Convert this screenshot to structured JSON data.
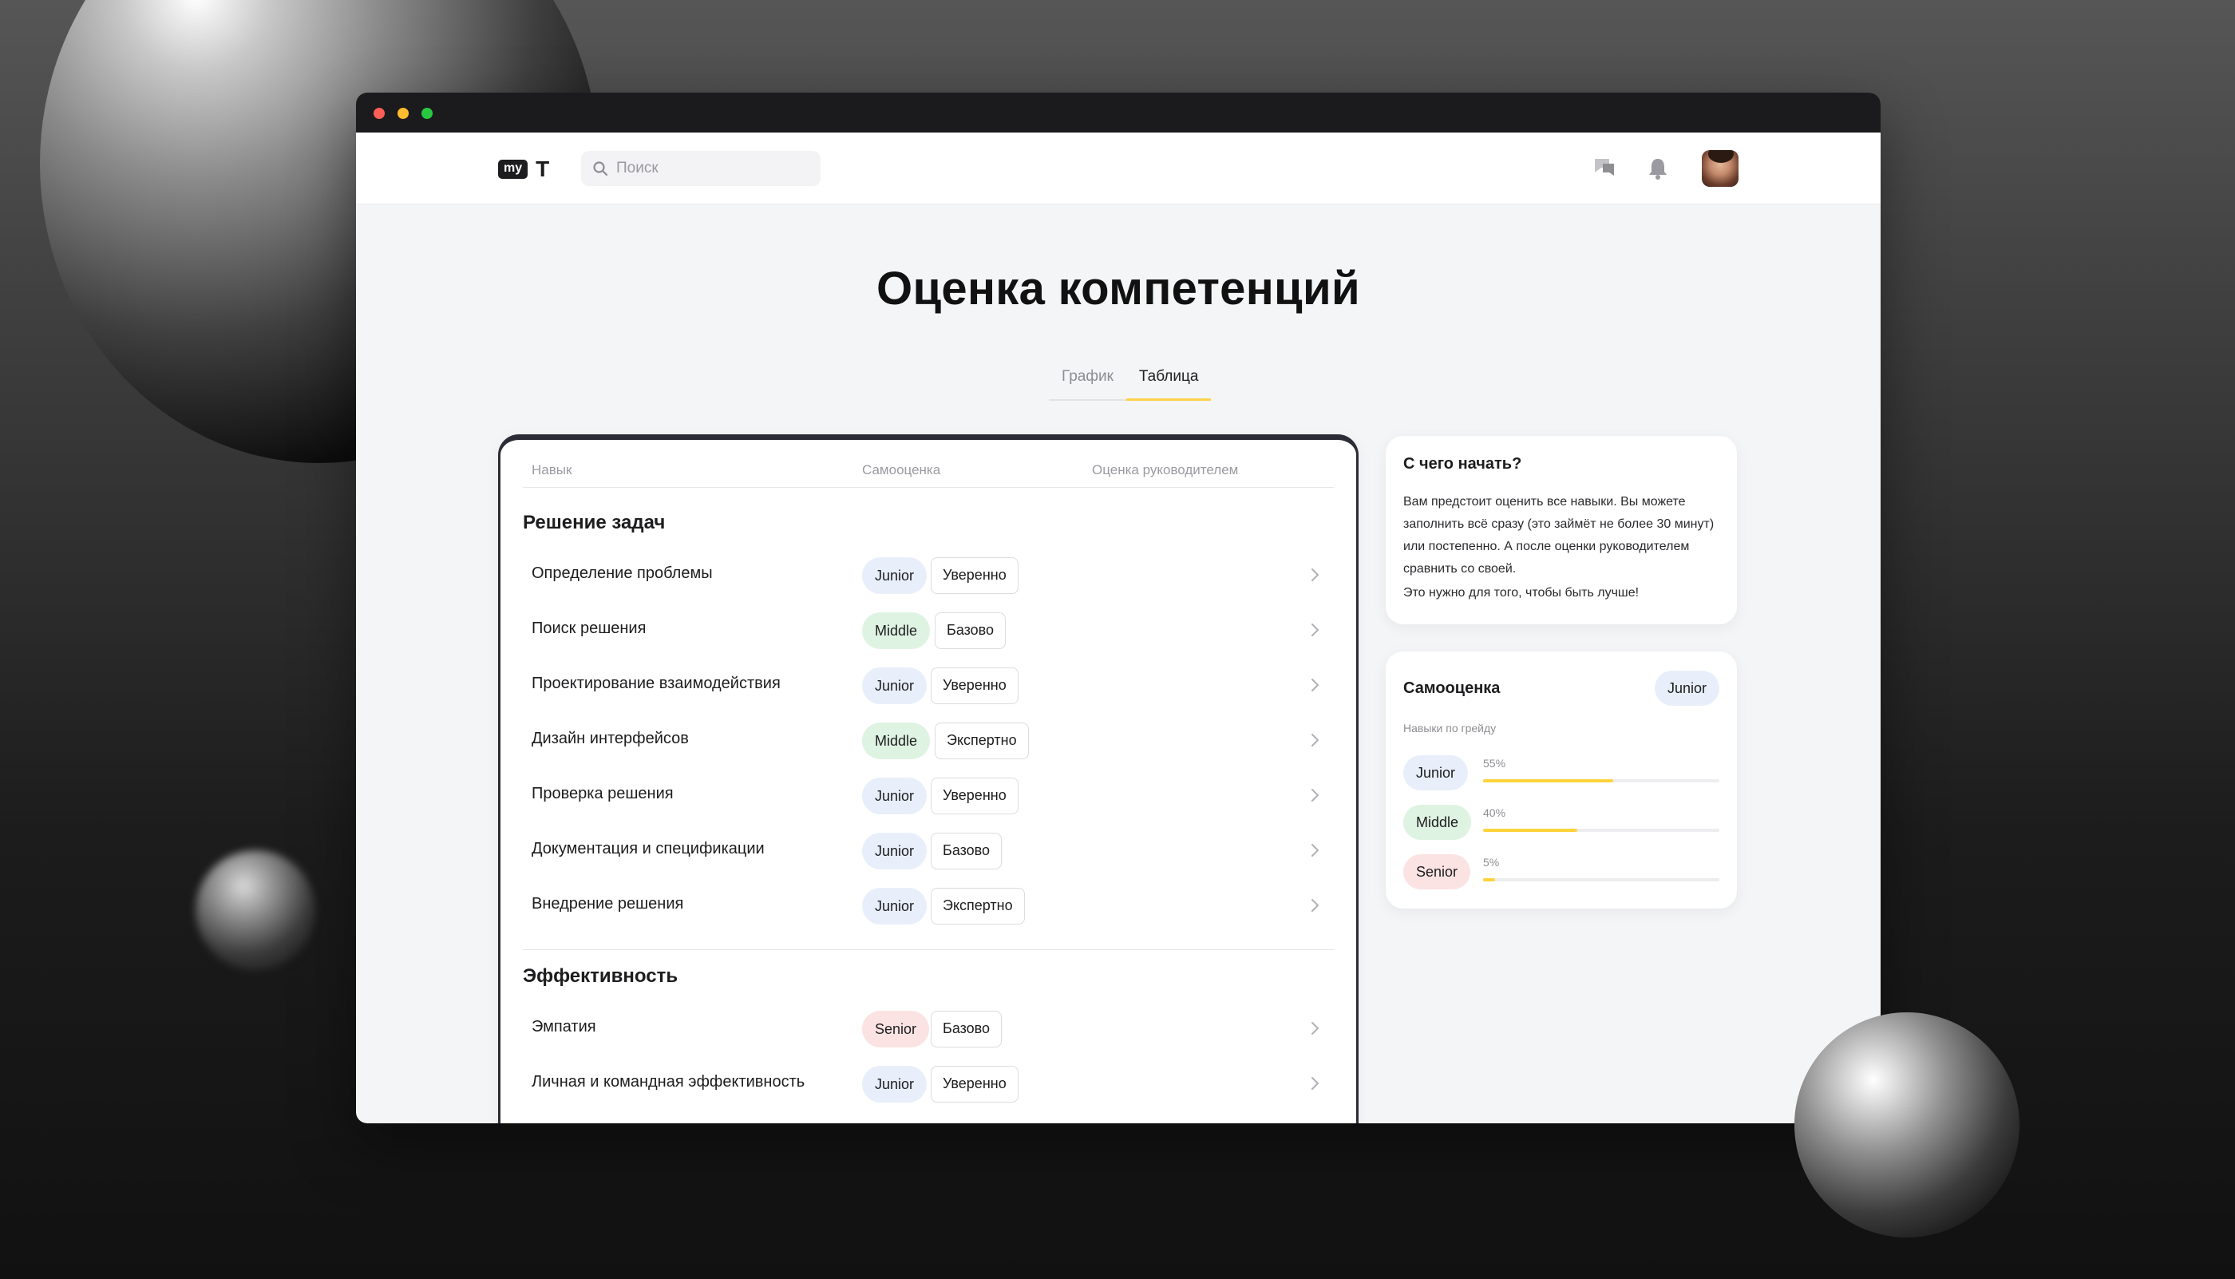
{
  "nav": {
    "logo_my": "my",
    "logo_t": "T",
    "search_placeholder": "Поиск",
    "icons": [
      "chat-icon",
      "bell-icon"
    ]
  },
  "page": {
    "title": "Оценка компетенций",
    "tabs": [
      {
        "label": "График",
        "active": false
      },
      {
        "label": "Таблица",
        "active": true
      }
    ]
  },
  "table": {
    "headers": {
      "skill": "Навык",
      "self": "Самооценка",
      "manager": "Оценка руководителем"
    },
    "sections": [
      {
        "title": "Решение задач",
        "rows": [
          {
            "skill": "Определение проблемы",
            "grade": "Junior",
            "level": "Уверенно"
          },
          {
            "skill": "Поиск решения",
            "grade": "Middle",
            "level": "Базово"
          },
          {
            "skill": "Проектирование взаимодействия",
            "grade": "Junior",
            "level": "Уверенно"
          },
          {
            "skill": "Дизайн интерфейсов",
            "grade": "Middle",
            "level": "Экспертно"
          },
          {
            "skill": "Проверка решения",
            "grade": "Junior",
            "level": "Уверенно"
          },
          {
            "skill": "Документация и спецификации",
            "grade": "Junior",
            "level": "Базово"
          },
          {
            "skill": "Внедрение решения",
            "grade": "Junior",
            "level": "Экспертно"
          }
        ]
      },
      {
        "title": "Эффективность",
        "rows": [
          {
            "skill": "Эмпатия",
            "grade": "Senior",
            "level": "Базово"
          },
          {
            "skill": "Личная и командная эффективность",
            "grade": "Junior",
            "level": "Уверенно"
          }
        ]
      }
    ]
  },
  "start_card": {
    "title": "С чего начать?",
    "text": "Вам предстоит оценить все навыки. Вы можете заполнить всё сразу (это займёт не более 30 минут) или постепенно. А после оценки руководителем сравнить со своей.",
    "text2": "Это нужно для того, чтобы быть лучше!"
  },
  "self_card": {
    "title": "Самооценка",
    "badge": "Junior",
    "subtitle": "Навыки по грейду",
    "grades": [
      {
        "name": "Junior",
        "percent_label": "55%",
        "percent": 55
      },
      {
        "name": "Middle",
        "percent_label": "40%",
        "percent": 40
      },
      {
        "name": "Senior",
        "percent_label": "5%",
        "percent": 5
      }
    ]
  },
  "colors": {
    "junior": "#e8effa",
    "middle": "#dff3e3",
    "senior": "#fbe3e3",
    "accent": "#ffd43b"
  }
}
